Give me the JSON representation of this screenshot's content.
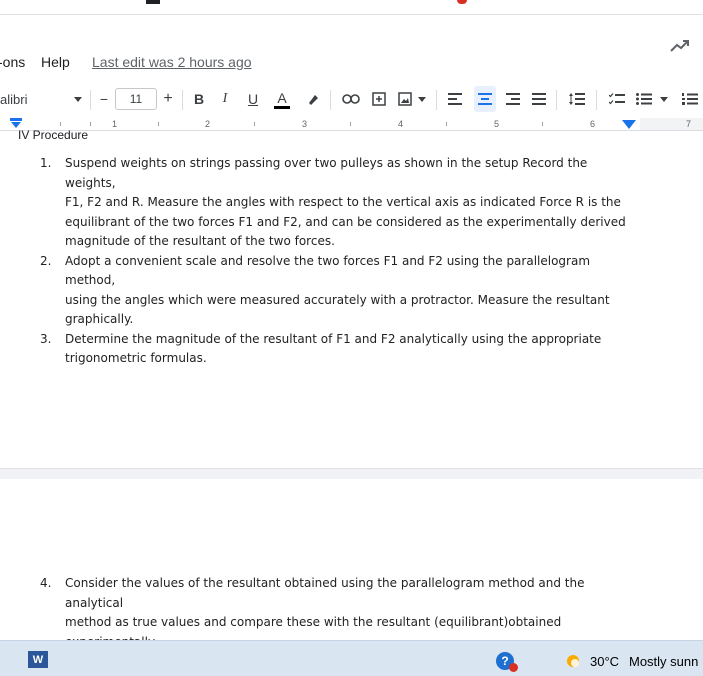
{
  "menu": {
    "items": [
      "ons",
      "Help"
    ],
    "last_edit": "Last edit was 2 hours ago"
  },
  "toolbar": {
    "font": "alibri",
    "font_size": "11",
    "minus": "−",
    "plus": "+",
    "bold": "B",
    "italic": "I",
    "underline": "U",
    "text_color": "A"
  },
  "ruler": {
    "numbers": [
      "1",
      "2",
      "3",
      "4",
      "5",
      "6",
      "7"
    ]
  },
  "document": {
    "heading": "IV Procedure",
    "steps_page1": [
      {
        "num": "1.",
        "lines": [
          "Suspend weights on strings passing over two pulleys as shown in the setup  Record the weights,",
          "F1, F2 and R.  Measure the angles with respect to the vertical axis as indicated  Force R is the",
          "equilibrant of the two forces F1 and F2, and can be considered as the experimentally derived",
          "magnitude of the resultant of the two forces."
        ]
      },
      {
        "num": "2.",
        "lines": [
          "Adopt a convenient scale and resolve the two forces F1 and F2 using the parallelogram method,",
          "using the angles which were measured accurately with a protractor.  Measure the resultant",
          "graphically."
        ]
      },
      {
        "num": "3.",
        "lines": [
          "Determine the magnitude of the resultant of F1 and F2 analytically using the appropriate",
          "trigonometric formulas."
        ]
      }
    ],
    "steps_page2": [
      {
        "num": "4.",
        "lines": [
          "Consider the values of the resultant obtained using the parallelogram method and the analytical",
          "method as true values and compare these with the resultant (equilibrant)obtained",
          "experimentally."
        ]
      }
    ]
  },
  "taskbar": {
    "word_label": "W",
    "help_label": "?",
    "temperature": "30°C",
    "condition": "Mostly sunn"
  },
  "colors": {
    "accent": "#1a73e8",
    "taskbar": "#d9e6f2"
  }
}
